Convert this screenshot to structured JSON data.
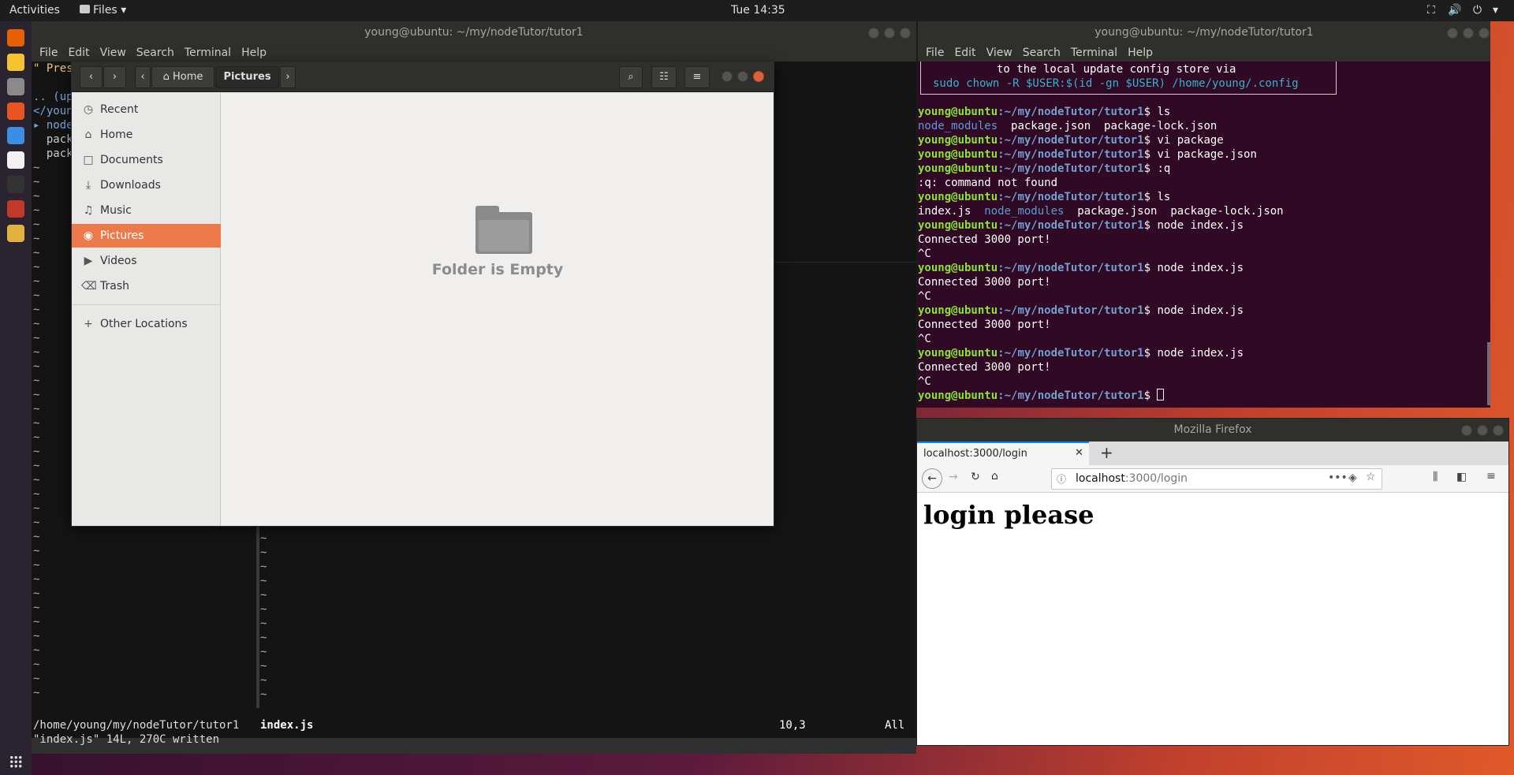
{
  "topbar": {
    "activities": "Activities",
    "app_menu": "Files",
    "clock": "Tue 14:35"
  },
  "dock": {
    "apps": [
      "firefox-icon",
      "rhythmbox-icon",
      "files-icon",
      "software-icon",
      "help-icon",
      "amazon-icon",
      "terminal-icon",
      "screenshot-icon",
      "sublime-icon"
    ]
  },
  "vim": {
    "title": "young@ubuntu: ~/my/nodeTutor/tutor1",
    "menu": [
      "File",
      "Edit",
      "View",
      "Search",
      "Terminal",
      "Help"
    ],
    "left_lines": [
      "\" Pres",
      "",
      ".. (up",
      "</youn",
      "▸ node",
      "  pack",
      "  pack"
    ],
    "status_left": "/home/young/my/nodeTutor/tutor1",
    "status_file": "index.js",
    "status_pos": "10,3",
    "status_all": "All",
    "cmdline": "\"index.js\" 14L, 270C written"
  },
  "files": {
    "breadcrumb_home": "Home",
    "breadcrumb_current": "Pictures",
    "sidebar": [
      {
        "icon": "◷",
        "label": "Recent"
      },
      {
        "icon": "⌂",
        "label": "Home"
      },
      {
        "icon": "□",
        "label": "Documents"
      },
      {
        "icon": "⤓",
        "label": "Downloads"
      },
      {
        "icon": "♫",
        "label": "Music"
      },
      {
        "icon": "◉",
        "label": "Pictures"
      },
      {
        "icon": "▶",
        "label": "Videos"
      },
      {
        "icon": "⌫",
        "label": "Trash"
      },
      {
        "icon": "+",
        "label": "Other Locations"
      }
    ],
    "empty_message": "Folder is Empty"
  },
  "terminal": {
    "title": "young@ubuntu: ~/my/nodeTutor/tutor1",
    "menu": [
      "File",
      "Edit",
      "View",
      "Search",
      "Terminal",
      "Help"
    ],
    "notice_line1": "to the local update config store via",
    "notice_line2": "sudo chown -R $USER:$(id -gn $USER) /home/young/.config",
    "prompt": "young@ubuntu",
    "path": ":~/my/nodeTutor/tutor1",
    "lines": [
      {
        "t": "p",
        "cmd": "ls"
      },
      {
        "t": "ls1",
        "a": "node_modules",
        "b": "  package.json  package-lock.json"
      },
      {
        "t": "p",
        "cmd": "vi package"
      },
      {
        "t": "p",
        "cmd": "vi package.json"
      },
      {
        "t": "p",
        "cmd": ":q"
      },
      {
        "t": "o",
        "text": ":q: command not found"
      },
      {
        "t": "p",
        "cmd": "ls"
      },
      {
        "t": "ls2",
        "a": "index.js  ",
        "b": "node_modules",
        "c": "  package.json  package-lock.json"
      },
      {
        "t": "p",
        "cmd": "node index.js"
      },
      {
        "t": "o",
        "text": "Connected 3000 port!"
      },
      {
        "t": "o",
        "text": "^C"
      },
      {
        "t": "p",
        "cmd": "node index.js"
      },
      {
        "t": "o",
        "text": "Connected 3000 port!"
      },
      {
        "t": "o",
        "text": "^C"
      },
      {
        "t": "p",
        "cmd": "node index.js"
      },
      {
        "t": "o",
        "text": "Connected 3000 port!"
      },
      {
        "t": "o",
        "text": "^C"
      },
      {
        "t": "p",
        "cmd": "node index.js"
      },
      {
        "t": "o",
        "text": "Connected 3000 port!"
      },
      {
        "t": "o",
        "text": "^C"
      },
      {
        "t": "p",
        "cmd": ""
      }
    ]
  },
  "firefox": {
    "title": "Mozilla Firefox",
    "tab_label": "localhost:3000/login",
    "url_host": "localhost",
    "url_path": ":3000/login",
    "page_heading": "login please"
  }
}
